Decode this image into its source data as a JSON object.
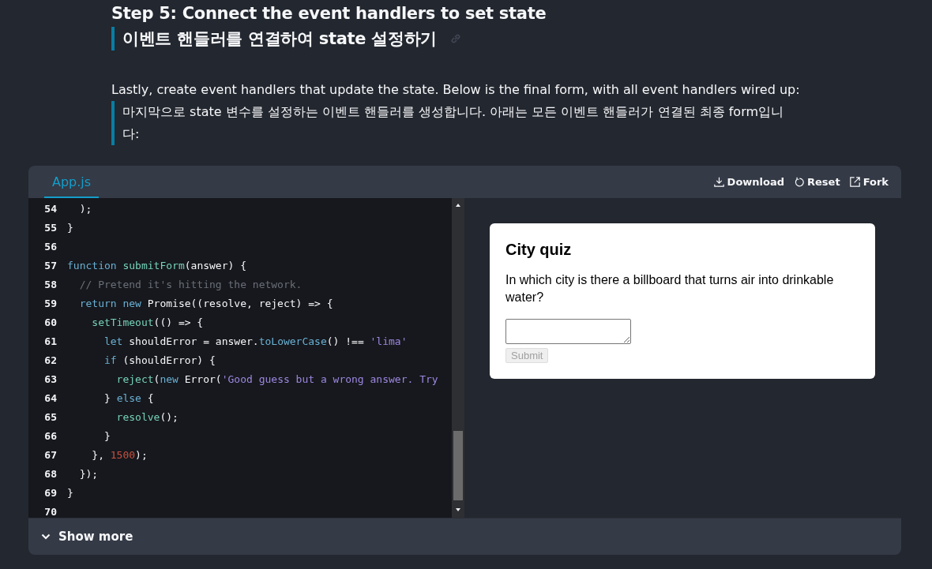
{
  "heading": {
    "title": "Step 5: Connect the event handlers to set state",
    "translation": "이벤트 핸들러를 연결하여 state 설정하기"
  },
  "intro": {
    "text": "Lastly, create event handlers that update the state. Below is the final form, with all event handlers wired up:",
    "translation": "마지막으로 state 변수를 설정하는 이벤트 핸들러를 생성합니다. 아래는 모든 이벤트 핸들러가 연결된 최종 form입니다:"
  },
  "sandbox": {
    "tabs": [
      {
        "label": "App.js",
        "selected": true
      }
    ],
    "actions": [
      {
        "kind": "download",
        "label": "Download"
      },
      {
        "kind": "reset",
        "label": "Reset"
      },
      {
        "kind": "fork",
        "label": "Fork"
      }
    ],
    "code": [
      {
        "number": "54",
        "tokens": [
          {
            "kind": "plain",
            "text": "  );"
          }
        ]
      },
      {
        "number": "55",
        "tokens": [
          {
            "kind": "plain",
            "text": "}"
          }
        ]
      },
      {
        "number": "56"
      },
      {
        "number": "57",
        "tokens": [
          {
            "kind": "keyword",
            "text": "function "
          },
          {
            "kind": "function",
            "text": "submitForm"
          },
          {
            "kind": "plain",
            "text": "(answer) {"
          }
        ]
      },
      {
        "number": "58",
        "tokens": [
          {
            "kind": "comment",
            "text": "  // Pretend it's hitting the network."
          }
        ]
      },
      {
        "number": "59",
        "tokens": [
          {
            "kind": "keyword",
            "text": "  return new "
          },
          {
            "kind": "plain",
            "text": "Promise((resolve, reject) => {"
          }
        ]
      },
      {
        "number": "60",
        "tokens": [
          {
            "kind": "function",
            "text": "    setTimeout"
          },
          {
            "kind": "plain",
            "text": "(() => {"
          }
        ]
      },
      {
        "number": "61",
        "tokens": [
          {
            "kind": "keyword",
            "text": "      let "
          },
          {
            "kind": "plain",
            "text": "shouldError = answer."
          },
          {
            "kind": "keyword",
            "text": "toLowerCase"
          },
          {
            "kind": "plain",
            "text": "() !== "
          },
          {
            "kind": "string",
            "text": "'lima'"
          }
        ]
      },
      {
        "number": "62",
        "tokens": [
          {
            "kind": "keyword",
            "text": "      if "
          },
          {
            "kind": "plain",
            "text": "(shouldError) {"
          }
        ]
      },
      {
        "number": "63",
        "tokens": [
          {
            "kind": "function",
            "text": "        reject"
          },
          {
            "kind": "plain",
            "text": "("
          },
          {
            "kind": "keyword",
            "text": "new "
          },
          {
            "kind": "plain",
            "text": "Error("
          },
          {
            "kind": "string",
            "text": "'Good guess but a wrong answer. Try"
          }
        ]
      },
      {
        "number": "64",
        "tokens": [
          {
            "kind": "plain",
            "text": "      } "
          },
          {
            "kind": "keyword",
            "text": "else "
          },
          {
            "kind": "plain",
            "text": "{"
          }
        ]
      },
      {
        "number": "65",
        "tokens": [
          {
            "kind": "function",
            "text": "        resolve"
          },
          {
            "kind": "plain",
            "text": "();"
          }
        ]
      },
      {
        "number": "66",
        "tokens": [
          {
            "kind": "plain",
            "text": "      }"
          }
        ]
      },
      {
        "number": "67",
        "tokens": [
          {
            "kind": "plain",
            "text": "    }, "
          },
          {
            "kind": "number",
            "text": "1500"
          },
          {
            "kind": "plain",
            "text": ");"
          }
        ]
      },
      {
        "number": "68",
        "tokens": [
          {
            "kind": "plain",
            "text": "  });"
          }
        ]
      },
      {
        "number": "69",
        "tokens": [
          {
            "kind": "plain",
            "text": "}"
          }
        ]
      },
      {
        "number": "70"
      }
    ],
    "preview": {
      "title": "City quiz",
      "question": "In which city is there a billboard that turns air into drinkable water?",
      "submit": {
        "label": "Submit",
        "disabled": true
      }
    },
    "show_more": "Show more"
  }
}
